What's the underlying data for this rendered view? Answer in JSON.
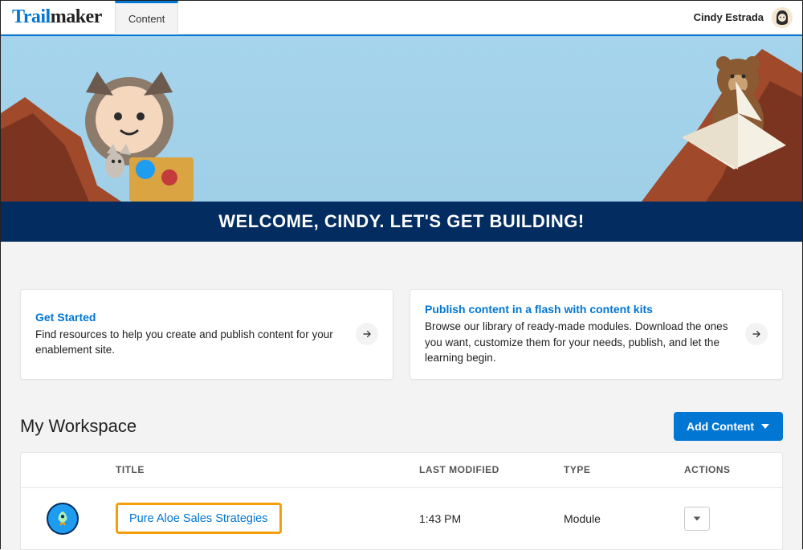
{
  "nav": {
    "logo_prefix": "Trail",
    "logo_suffix": "maker",
    "tab_content": "Content",
    "user_name": "Cindy Estrada"
  },
  "hero": {
    "welcome_banner": "WELCOME, CINDY. LET'S GET BUILDING!"
  },
  "cards": {
    "get_started_title": "Get Started",
    "get_started_text": "Find resources to help you create and publish content for your enablement site.",
    "publish_title": "Publish content in a flash with content kits",
    "publish_text": "Browse our library of ready-made modules. Download the ones you want, customize them for your needs, publish, and let the learning begin."
  },
  "workspace": {
    "heading": "My Workspace",
    "add_button": "Add Content",
    "columns": {
      "title": "TITLE",
      "last_modified": "LAST MODIFIED",
      "type": "TYPE",
      "actions": "ACTIONS"
    },
    "rows": [
      {
        "title": "Pure Aloe Sales Strategies",
        "last_modified": "1:43 PM",
        "type": "Module"
      }
    ]
  }
}
